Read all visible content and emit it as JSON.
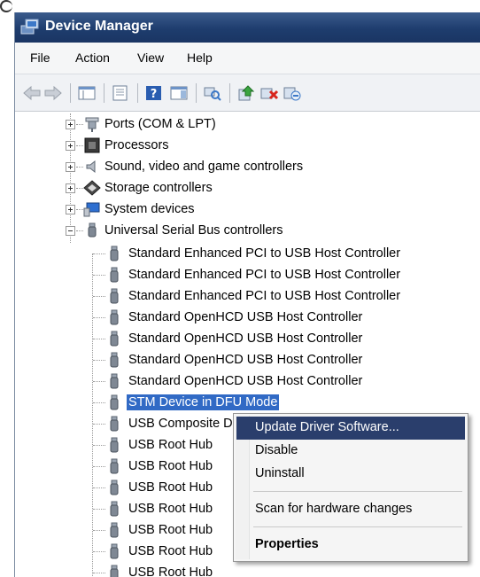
{
  "window": {
    "title": "Device Manager"
  },
  "menubar": {
    "items": [
      "File",
      "Action",
      "View",
      "Help"
    ]
  },
  "toolbar": {
    "buttons": [
      "back-arrow-icon",
      "forward-arrow-icon",
      "show-hide-console-tree-icon",
      "properties-icon",
      "help-icon",
      "show-hide-action-pane-icon",
      "scan-hardware-icon",
      "update-driver-icon",
      "uninstall-device-icon",
      "disable-device-icon"
    ]
  },
  "tree": {
    "categories": [
      {
        "label": "Ports (COM & LPT)",
        "icon": "port-icon"
      },
      {
        "label": "Processors",
        "icon": "processor-icon"
      },
      {
        "label": "Sound, video and game controllers",
        "icon": "speaker-icon"
      },
      {
        "label": "Storage controllers",
        "icon": "storage-icon"
      },
      {
        "label": "System devices",
        "icon": "system-devices-icon"
      },
      {
        "label": "Universal Serial Bus controllers",
        "icon": "usb-icon"
      }
    ],
    "usb_devices": [
      "Standard Enhanced PCI to USB Host Controller",
      "Standard Enhanced PCI to USB Host Controller",
      "Standard Enhanced PCI to USB Host Controller",
      "Standard OpenHCD USB Host Controller",
      "Standard OpenHCD USB Host Controller",
      "Standard OpenHCD USB Host Controller",
      "Standard OpenHCD USB Host Controller",
      "STM Device in DFU Mode",
      "USB Composite Device",
      "USB Root Hub",
      "USB Root Hub",
      "USB Root Hub",
      "USB Root Hub",
      "USB Root Hub",
      "USB Root Hub",
      "USB Root Hub"
    ]
  },
  "context_menu": {
    "update_driver": "Update Driver Software...",
    "disable": "Disable",
    "uninstall": "Uninstall",
    "scan": "Scan for hardware changes",
    "properties": "Properties"
  },
  "colors": {
    "titlebar": "#1e3d6e",
    "selection": "#316ac5",
    "menu_highlight": "#2a3e6c"
  }
}
